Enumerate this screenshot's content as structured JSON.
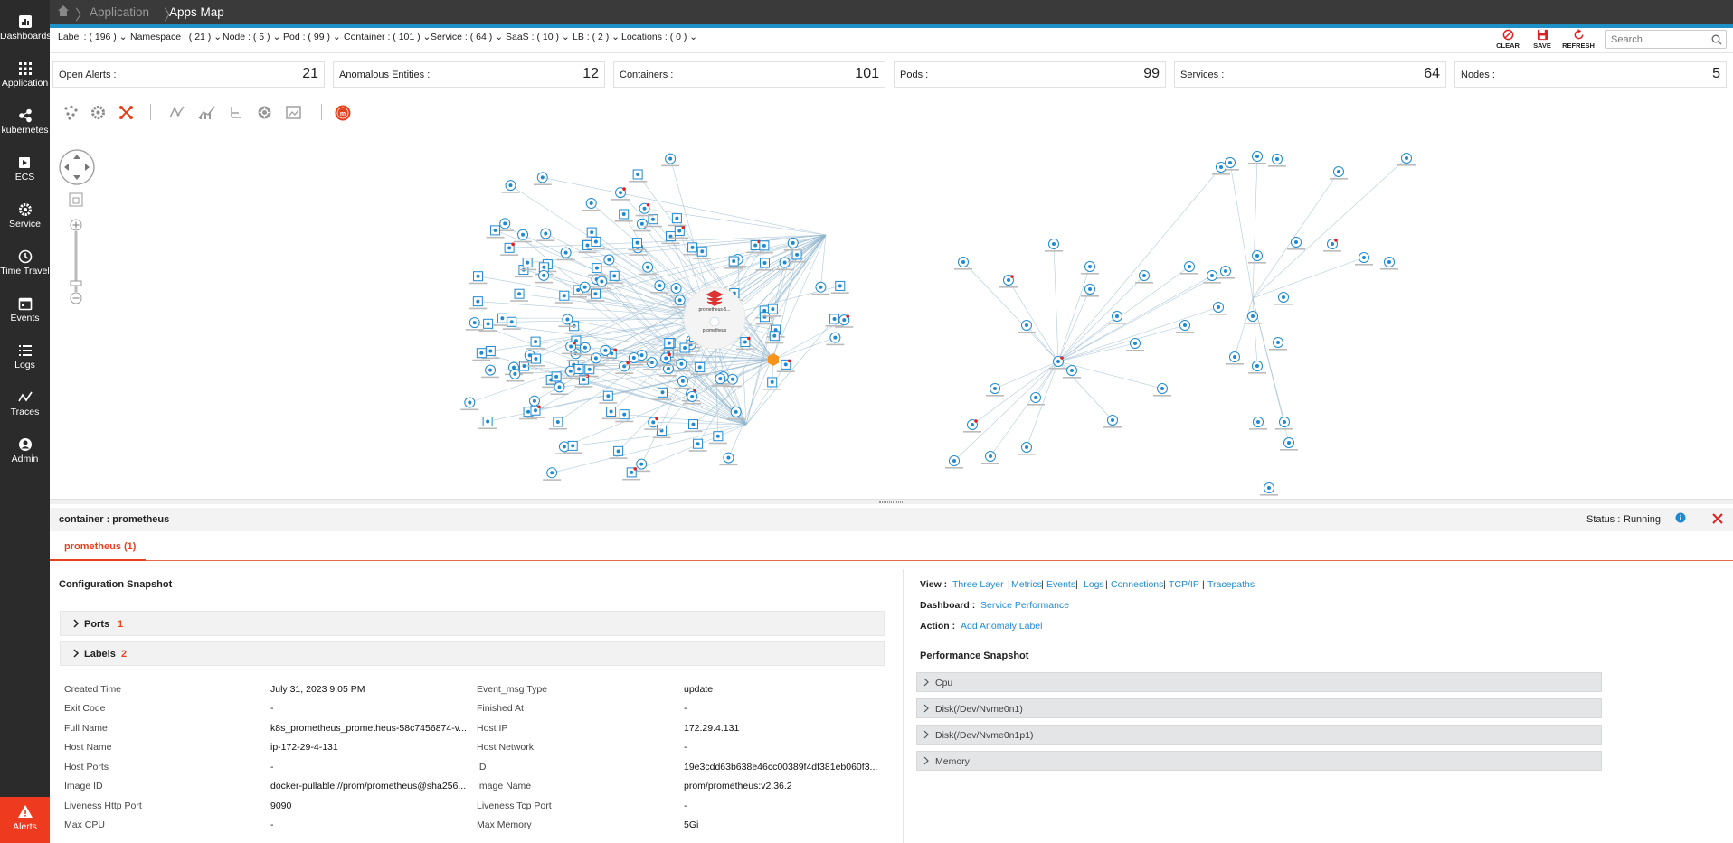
{
  "nav": {
    "items": [
      {
        "label": "Dashboards",
        "icon": "dashboard-icon"
      },
      {
        "label": "Application",
        "icon": "grid-icon"
      },
      {
        "label": "kubernetes",
        "icon": "share-icon"
      },
      {
        "label": "ECS",
        "icon": "ecs-icon"
      },
      {
        "label": "Service",
        "icon": "gear-icon"
      },
      {
        "label": "Time Travel",
        "icon": "clock-icon"
      },
      {
        "label": "Events",
        "icon": "calendar-icon"
      },
      {
        "label": "Logs",
        "icon": "list-icon"
      },
      {
        "label": "Traces",
        "icon": "traces-icon"
      },
      {
        "label": "Admin",
        "icon": "user-icon"
      }
    ],
    "alerts_label": "Alerts",
    "bg": "#2b2b2b",
    "alert_color": "#ee3a1e"
  },
  "breadcrumb": {
    "items": [
      "Application",
      "Apps Map"
    ]
  },
  "filters": [
    "Label : ( 196 )",
    "Namespace : ( 21 )",
    "Node : ( 5 )",
    "Pod : ( 99 )",
    "Container : ( 101 )",
    "Service : ( 64 )",
    "SaaS : ( 10 )",
    "LB : ( 2 )",
    "Locations : ( 0 )"
  ],
  "toolbar": {
    "clear": "CLEAR",
    "save": "SAVE",
    "refresh": "REFRESH",
    "search_placeholder": "Search"
  },
  "summary": [
    {
      "label": "Open Alerts :",
      "value": "21"
    },
    {
      "label": "Anomalous Entities :",
      "value": "12"
    },
    {
      "label": "Containers :",
      "value": "101"
    },
    {
      "label": "Pods :",
      "value": "99"
    },
    {
      "label": "Services :",
      "value": "64"
    },
    {
      "label": "Nodes :",
      "value": "5"
    }
  ],
  "graph": {
    "node_color": "#1f8ad1",
    "edge_color": "#8fb4cc",
    "alert_color": "#e02020",
    "hub_labels": [
      "prometheus-5...",
      "prometheus"
    ]
  },
  "panel": {
    "title": "container : prometheus",
    "status_label": "Status :",
    "status_value": "Running",
    "tab": "prometheus (1)",
    "config_title": "Configuration Snapshot",
    "accordions": [
      {
        "label": "Ports",
        "count": "1"
      },
      {
        "label": "Labels",
        "count": "2"
      }
    ],
    "details_left": [
      {
        "k": "Created Time",
        "v": "July 31, 2023 9:05 PM"
      },
      {
        "k": "Exit Code",
        "v": "-"
      },
      {
        "k": "Full Name",
        "v": "k8s_prometheus_prometheus-58c7456874-v..."
      },
      {
        "k": "Host Name",
        "v": "ip-172-29-4-131"
      },
      {
        "k": "Host Ports",
        "v": "-"
      },
      {
        "k": "Image ID",
        "v": "docker-pullable://prom/prometheus@sha256..."
      },
      {
        "k": "Liveness Http Port",
        "v": "9090"
      },
      {
        "k": "Max CPU",
        "v": "-"
      }
    ],
    "details_right": [
      {
        "k": "Event_msg Type",
        "v": "update"
      },
      {
        "k": "Finished At",
        "v": "-"
      },
      {
        "k": "Host IP",
        "v": "172.29.4.131"
      },
      {
        "k": "Host Network",
        "v": "-"
      },
      {
        "k": "ID",
        "v": "19e3cdd63b638e46cc00389f4df381eb060f3..."
      },
      {
        "k": "Image Name",
        "v": "prom/prometheus:v2.36.2"
      },
      {
        "k": "Liveness Tcp Port",
        "v": "-"
      },
      {
        "k": "Max Memory",
        "v": "5Gi"
      }
    ],
    "view_label": "View :",
    "view_links": [
      "Three Layer",
      "Metrics",
      "Events",
      "Logs",
      "Connections",
      "TCP/IP",
      "Tracepaths"
    ],
    "dashboard_label": "Dashboard :",
    "dashboard_link": "Service Performance",
    "action_label": "Action :",
    "action_link": "Add Anomaly Label",
    "perf_title": "Performance Snapshot",
    "perf_items": [
      "Cpu",
      "Disk(/Dev/Nvme0n1)",
      "Disk(/Dev/Nvme0n1p1)",
      "Memory"
    ],
    "accent": "#e6421e",
    "link_color": "#1f8ad1"
  }
}
